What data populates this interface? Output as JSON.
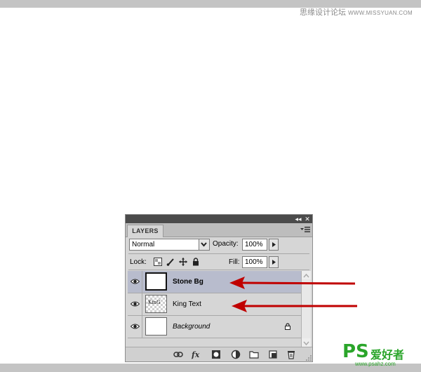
{
  "watermark": {
    "site_cn": "思缘设计论坛",
    "site_url": "WWW.MISSYUAN.COM"
  },
  "panel": {
    "tab_label": "LAYERS",
    "blend_mode": "Normal",
    "opacity_label": "Opacity:",
    "opacity_value": "100%",
    "lock_label": "Lock:",
    "fill_label": "Fill:",
    "fill_value": "100%",
    "layers": [
      {
        "name": "Stone Bg",
        "selected": true,
        "style": "bold",
        "thumbnail": "white"
      },
      {
        "name": "King Text",
        "selected": false,
        "style": "normal",
        "thumbnail": "transparent-text",
        "thumb_text": "KinG"
      },
      {
        "name": "Background",
        "selected": false,
        "style": "italic",
        "thumbnail": "white",
        "locked": true
      }
    ],
    "footer_icons": [
      "link-icon",
      "fx-icon",
      "mask-icon",
      "adjustment-icon",
      "folder-icon",
      "new-layer-icon",
      "trash-icon"
    ]
  },
  "annotations": {
    "arrow_color": "#c00000"
  },
  "logo": {
    "ps": "PS",
    "cn": "爱好者",
    "url": "www.psahz.com"
  },
  "colors": {
    "selected_row": "#b8bccd",
    "logo_green": "#2aa52a"
  }
}
